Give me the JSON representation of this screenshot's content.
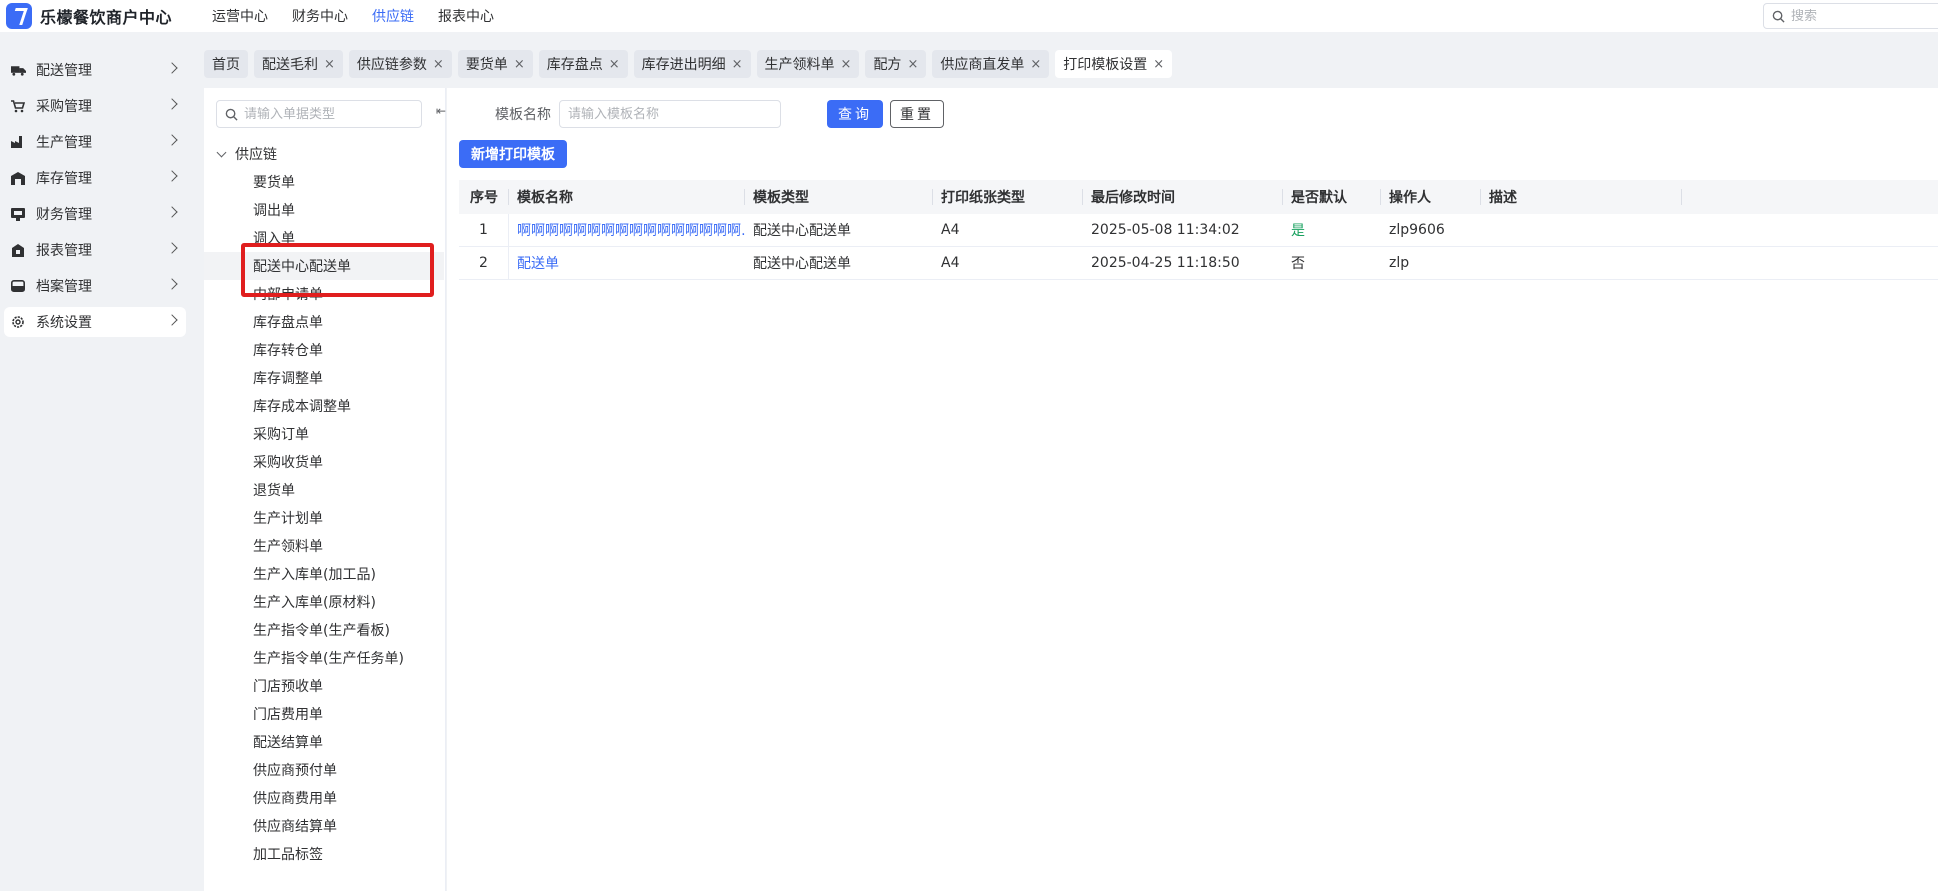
{
  "app": {
    "title": "乐檬餐饮商户中心"
  },
  "topnav": [
    {
      "label": "运营中心",
      "active": false
    },
    {
      "label": "财务中心",
      "active": false
    },
    {
      "label": "供应链",
      "active": true
    },
    {
      "label": "报表中心",
      "active": false
    }
  ],
  "top_search": {
    "placeholder": "搜索"
  },
  "sidebar": {
    "items": [
      {
        "label": "配送管理",
        "icon": "truck-icon"
      },
      {
        "label": "采购管理",
        "icon": "cart-icon"
      },
      {
        "label": "生产管理",
        "icon": "factory-icon"
      },
      {
        "label": "库存管理",
        "icon": "warehouse-icon"
      },
      {
        "label": "财务管理",
        "icon": "finance-icon"
      },
      {
        "label": "报表管理",
        "icon": "report-icon"
      },
      {
        "label": "档案管理",
        "icon": "archive-icon"
      },
      {
        "label": "系统设置",
        "icon": "gear-icon"
      }
    ]
  },
  "tabs": [
    {
      "label": "首页",
      "closable": false
    },
    {
      "label": "配送毛利",
      "closable": true
    },
    {
      "label": "供应链参数",
      "closable": true
    },
    {
      "label": "要货单",
      "closable": true
    },
    {
      "label": "库存盘点",
      "closable": true
    },
    {
      "label": "库存进出明细",
      "closable": true
    },
    {
      "label": "生产领料单",
      "closable": true
    },
    {
      "label": "配方",
      "closable": true
    },
    {
      "label": "供应商直发单",
      "closable": true
    },
    {
      "label": "打印模板设置",
      "closable": true
    }
  ],
  "tab_close_glyph": "×",
  "tree": {
    "search_placeholder": "请输入单据类型",
    "collapse_glyph": "⇤",
    "root": "供应链",
    "items": [
      "要货单",
      "调出单",
      "调入单",
      "配送中心配送单",
      "内部申请单",
      "库存盘点单",
      "库存转仓单",
      "库存调整单",
      "库存成本调整单",
      "采购订单",
      "采购收货单",
      "退货单",
      "生产计划单",
      "生产领料单",
      "生产入库单(加工品)",
      "生产入库单(原材料)",
      "生产指令单(生产看板)",
      "生产指令单(生产任务单)",
      "门店预收单",
      "门店费用单",
      "配送结算单",
      "供应商预付单",
      "供应商费用单",
      "供应商结算单",
      "加工品标签"
    ]
  },
  "form": {
    "label": "模板名称",
    "placeholder": "请输入模板名称",
    "query_label": "查询",
    "reset_label": "重置",
    "add_label": "新增打印模板"
  },
  "table": {
    "headers": [
      "序号",
      "模板名称",
      "模板类型",
      "打印纸张类型",
      "最后修改时间",
      "是否默认",
      "操作人",
      "描述",
      ""
    ],
    "rows": [
      {
        "idx": "1",
        "name": "啊啊啊啊啊啊啊啊啊啊啊啊啊啊啊啊…",
        "type": "配送中心配送单",
        "paper": "A4",
        "time": "2025-05-08 11:34:02",
        "default": "是",
        "operator": "zlp9606",
        "desc": ""
      },
      {
        "idx": "2",
        "name": "配送单",
        "type": "配送中心配送单",
        "paper": "A4",
        "time": "2025-04-25 11:18:50",
        "default": "否",
        "operator": "zlp",
        "desc": ""
      }
    ]
  },
  "colors": {
    "accent": "#3b6cf6",
    "highlight": "#e01e1e",
    "yes": "#19a15f"
  }
}
